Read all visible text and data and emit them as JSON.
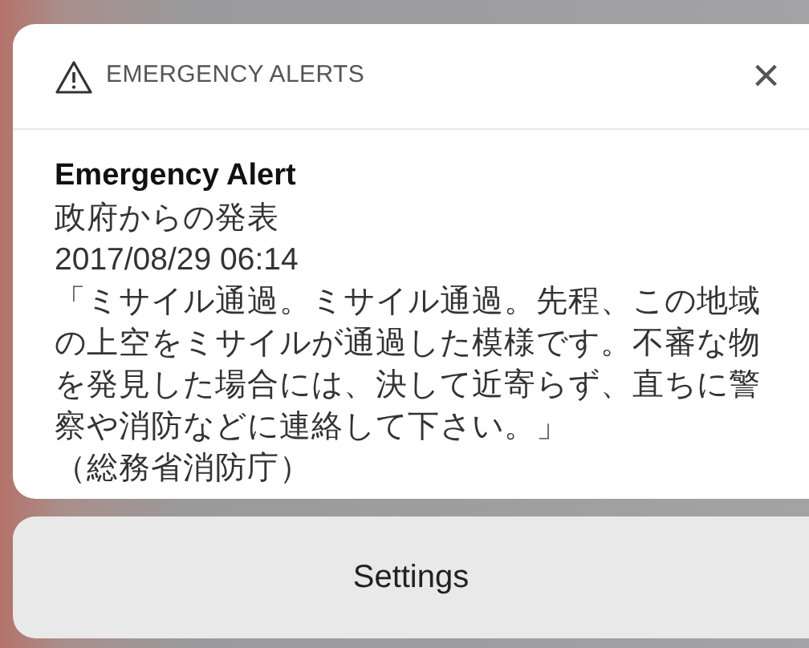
{
  "notification": {
    "app_name": "EMERGENCY ALERTS",
    "close_label": "×",
    "title": "Emergency Alert",
    "sender": "政府からの発表",
    "timestamp": "2017/08/29 06:14",
    "message": "「ミサイル通過。ミサイル通過。先程、この地域の上空をミサイルが通過した模様です。不審な物を発見した場合には、決して近寄らず、直ちに警察や消防などに連絡して下さい。」",
    "source": "（総務省消防庁）"
  },
  "buttons": [
    "Settings"
  ]
}
